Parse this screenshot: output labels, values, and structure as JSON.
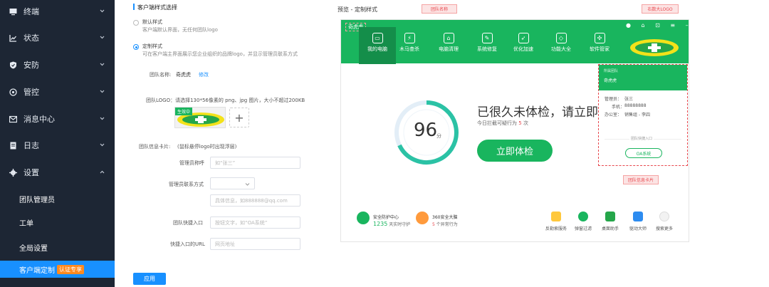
{
  "sidebar": {
    "items": [
      {
        "label": "终端"
      },
      {
        "label": "状态"
      },
      {
        "label": "安防"
      },
      {
        "label": "管控"
      },
      {
        "label": "消息中心"
      },
      {
        "label": "日志"
      },
      {
        "label": "设置"
      }
    ],
    "subitems": [
      {
        "label": "团队管理员"
      },
      {
        "label": "工单"
      },
      {
        "label": "全局设置"
      },
      {
        "label": "客户端定制"
      }
    ],
    "active_tag": "认证专享"
  },
  "form": {
    "section_title": "客户端样式选择",
    "default_style": {
      "label": "默认样式",
      "desc": "客户端默认界面，无任何团队logo"
    },
    "custom_style": {
      "label": "定制样式",
      "desc": "可在客户端主界面展示您企业组织的品牌logo，并显示管理员联系方式"
    },
    "team_name_label": "团队名称:",
    "team_name_value": "奇虎虎",
    "edit_link": "修改",
    "logo_label": "团队LOGO：请选择130*56像素的 png、jpg 图片，大小不超过200KB",
    "logo_badge": "生效中",
    "card_label": "团队信息卡片:",
    "card_hint": "(鼠标悬停logo时出现浮层)",
    "admin_name_label": "管理员称呼",
    "admin_name_placeholder": "如“张三”",
    "contact_label": "管理员联系方式",
    "contact_placeholder": "具体信息，如888888@qq.com",
    "entry_label": "团队快捷入口",
    "entry_placeholder": "按钮文字，如“OA系统”",
    "entry_url_label": "快捷入口的URL",
    "entry_url_placeholder": "网页地址",
    "apply_button": "应用"
  },
  "preview": {
    "title": "预览 - 定制样式",
    "tag_team_name": "团队名称",
    "tag_logo": "右数大LOGO",
    "tag_card": "团队信息卡片",
    "app_name": "奇虎虎",
    "tabs": [
      {
        "label": "我的电脑"
      },
      {
        "label": "木马查杀"
      },
      {
        "label": "电脑清理"
      },
      {
        "label": "系统修复"
      },
      {
        "label": "优化加速"
      },
      {
        "label": "功能大全"
      },
      {
        "label": "软件管家"
      }
    ],
    "score": "96",
    "score_unit": "分",
    "headline": "已很久未体检，请立即体检",
    "subline_prefix": "今日拦截可疑行为",
    "subline_count": "5",
    "subline_suffix": "次",
    "check_button": "立即体检",
    "card": {
      "header": "所属团队",
      "team": "奇虎虎",
      "admin_label": "管理员：",
      "admin": "张三",
      "phone_label": "手机：",
      "phone": "88888888",
      "office_label": "办公室：",
      "office": "销售组 - 李四",
      "entry_title": "团队快捷入口",
      "entry_button": "OA系统"
    },
    "footer_left": [
      {
        "title": "安全防护中心",
        "count": "1235",
        "suffix": "天实时守护"
      },
      {
        "title": "360安全大脑",
        "count": "5",
        "suffix": "个异常行为"
      }
    ],
    "footer_icons": [
      {
        "label": "反勒索服务"
      },
      {
        "label": "弹窗过滤"
      },
      {
        "label": "桌面助手"
      },
      {
        "label": "驱动大师"
      },
      {
        "label": "搜索更多"
      }
    ]
  },
  "colors": {
    "sidebar": "#1d2634",
    "accent": "#1890ff",
    "brand_green": "#19b55e",
    "tag": "#ff8a1f"
  }
}
